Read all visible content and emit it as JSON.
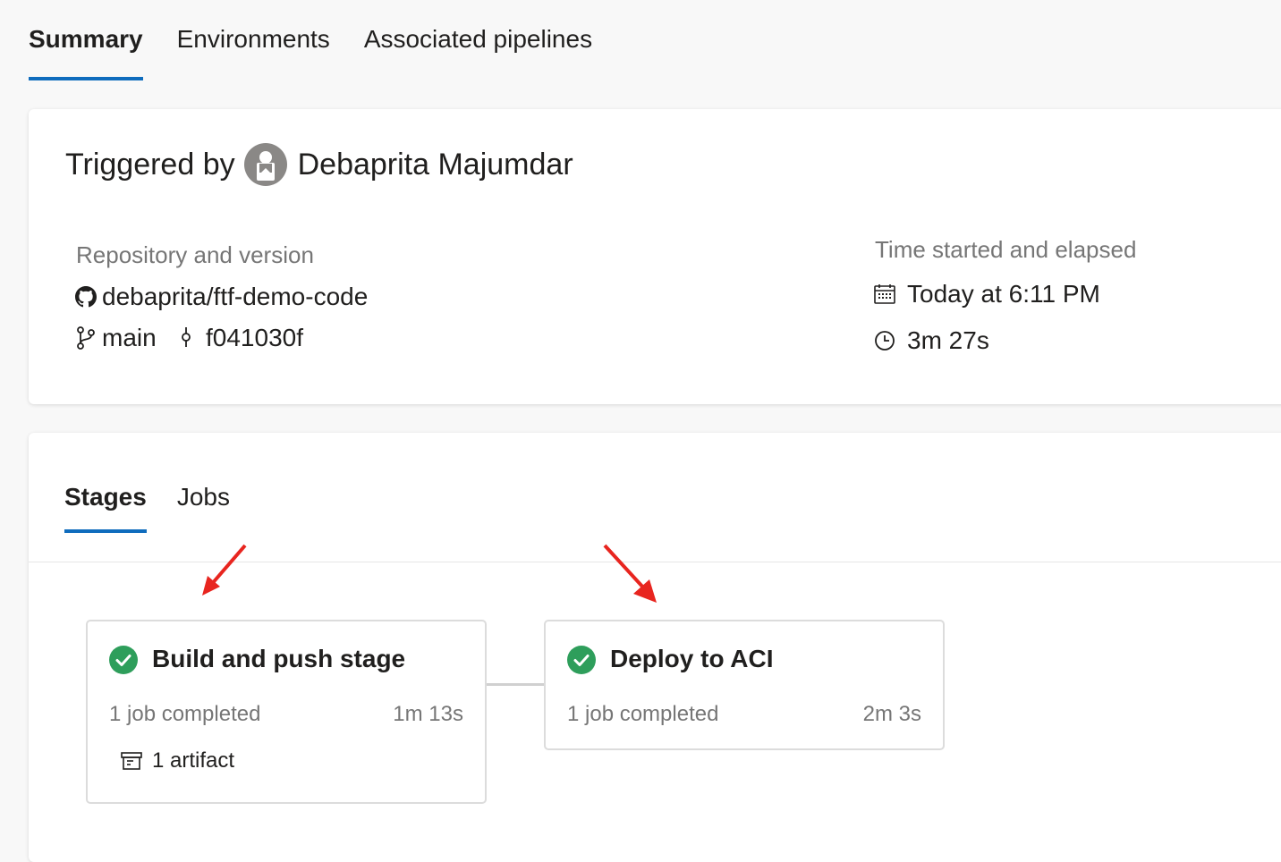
{
  "top_tabs": [
    {
      "label": "Summary",
      "active": true
    },
    {
      "label": "Environments",
      "active": false
    },
    {
      "label": "Associated pipelines",
      "active": false
    }
  ],
  "trigger": {
    "prefix": "Triggered by",
    "user": "Debaprita Majumdar"
  },
  "repository": {
    "label": "Repository and version",
    "repo_icon": "github-icon",
    "repo": "debaprita/ftf-demo-code",
    "branch_icon": "branch-icon",
    "branch": "main",
    "commit_icon": "commit-icon",
    "commit": "f041030f"
  },
  "time": {
    "label": "Time started and elapsed",
    "started_icon": "calendar-icon",
    "started": "Today at 6:11 PM",
    "elapsed_icon": "clock-icon",
    "elapsed": "3m 27s"
  },
  "stage_tabs": [
    {
      "label": "Stages",
      "active": true
    },
    {
      "label": "Jobs",
      "active": false
    }
  ],
  "stages": [
    {
      "name": "Build and push stage",
      "status": "succeeded",
      "jobs": "1 job completed",
      "duration": "1m 13s",
      "artifact": "1 artifact"
    },
    {
      "name": "Deploy to ACI",
      "status": "succeeded",
      "jobs": "1 job completed",
      "duration": "2m 3s"
    }
  ],
  "colors": {
    "accent": "#0f6cbd",
    "success": "#2e9e5b",
    "annotation_arrow": "#e8251f"
  }
}
